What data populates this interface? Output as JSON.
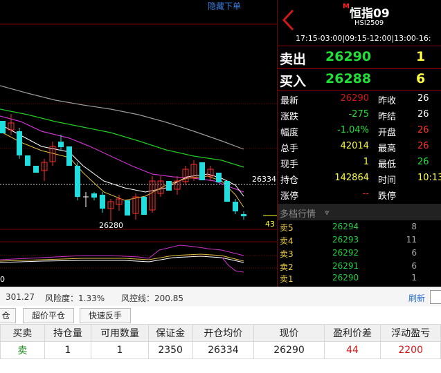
{
  "chart": {
    "hide_order_link": "隐藏下单",
    "price_marker": "26334",
    "low_marker": "26280",
    "volume_marker": "43",
    "indicator_axis_zero": "0"
  },
  "quote": {
    "title": "恒指09",
    "title_badge": "M",
    "symbol": "HSI2509",
    "sessions": "17:15-03:00|09:15-12:00|13:00-16:",
    "ask": {
      "label": "卖出",
      "price": "26290",
      "qty": "1"
    },
    "bid": {
      "label": "买入",
      "price": "26288",
      "qty": "6"
    },
    "rows": [
      {
        "k1": "最新",
        "v1": "26290",
        "k2": "昨收",
        "v2": "26"
      },
      {
        "k1": "涨跌",
        "v1": "-275",
        "k2": "昨结",
        "v2": "26"
      },
      {
        "k1": "幅度",
        "v1": "-1.04%",
        "k2": "开盘",
        "v2": "26"
      },
      {
        "k1": "总手",
        "v1": "42014",
        "k2": "最高",
        "v2": "26"
      },
      {
        "k1": "现手",
        "v1": "1",
        "k2": "最低",
        "v2": "26"
      },
      {
        "k1": "持仓",
        "v1": "142864",
        "k2": "时间",
        "v2": "10:13"
      },
      {
        "k1": "涨停",
        "v1": "--",
        "k2": "跌停",
        "v2": ""
      }
    ],
    "depth_title": "多档行情",
    "depth_icon": "double-chevron-down-icon",
    "depth": [
      {
        "k": "卖5",
        "p": "26294",
        "q": "8"
      },
      {
        "k": "卖4",
        "p": "26293",
        "q": "11"
      },
      {
        "k": "卖3",
        "p": "26292",
        "q": "6"
      },
      {
        "k": "卖2",
        "p": "26291",
        "q": "6"
      },
      {
        "k": "卖1",
        "p": "26290",
        "q": "1"
      }
    ]
  },
  "account": {
    "value1": "301.27",
    "risk": "风险度：1.33%",
    "control": "风控线：200.85",
    "refresh": "刷新"
  },
  "buttons": {
    "close": "仓",
    "super_close": "超价平仓",
    "fast_reverse": "快速反手"
  },
  "positions": {
    "headers": [
      "买卖",
      "持仓量",
      "可用数量",
      "保证金",
      "开仓均价",
      "现价",
      "盈利价差",
      "浮动盈亏"
    ],
    "row": {
      "side": "卖",
      "qty": "1",
      "avail": "1",
      "margin": "2350",
      "open_avg": "26334",
      "price": "26290",
      "diff": "44",
      "pnl": "2200"
    }
  },
  "colors": {
    "up": "#ff3030",
    "down": "#22e03a",
    "grid": "#8b0000",
    "refresh": "#2b6fd6"
  }
}
